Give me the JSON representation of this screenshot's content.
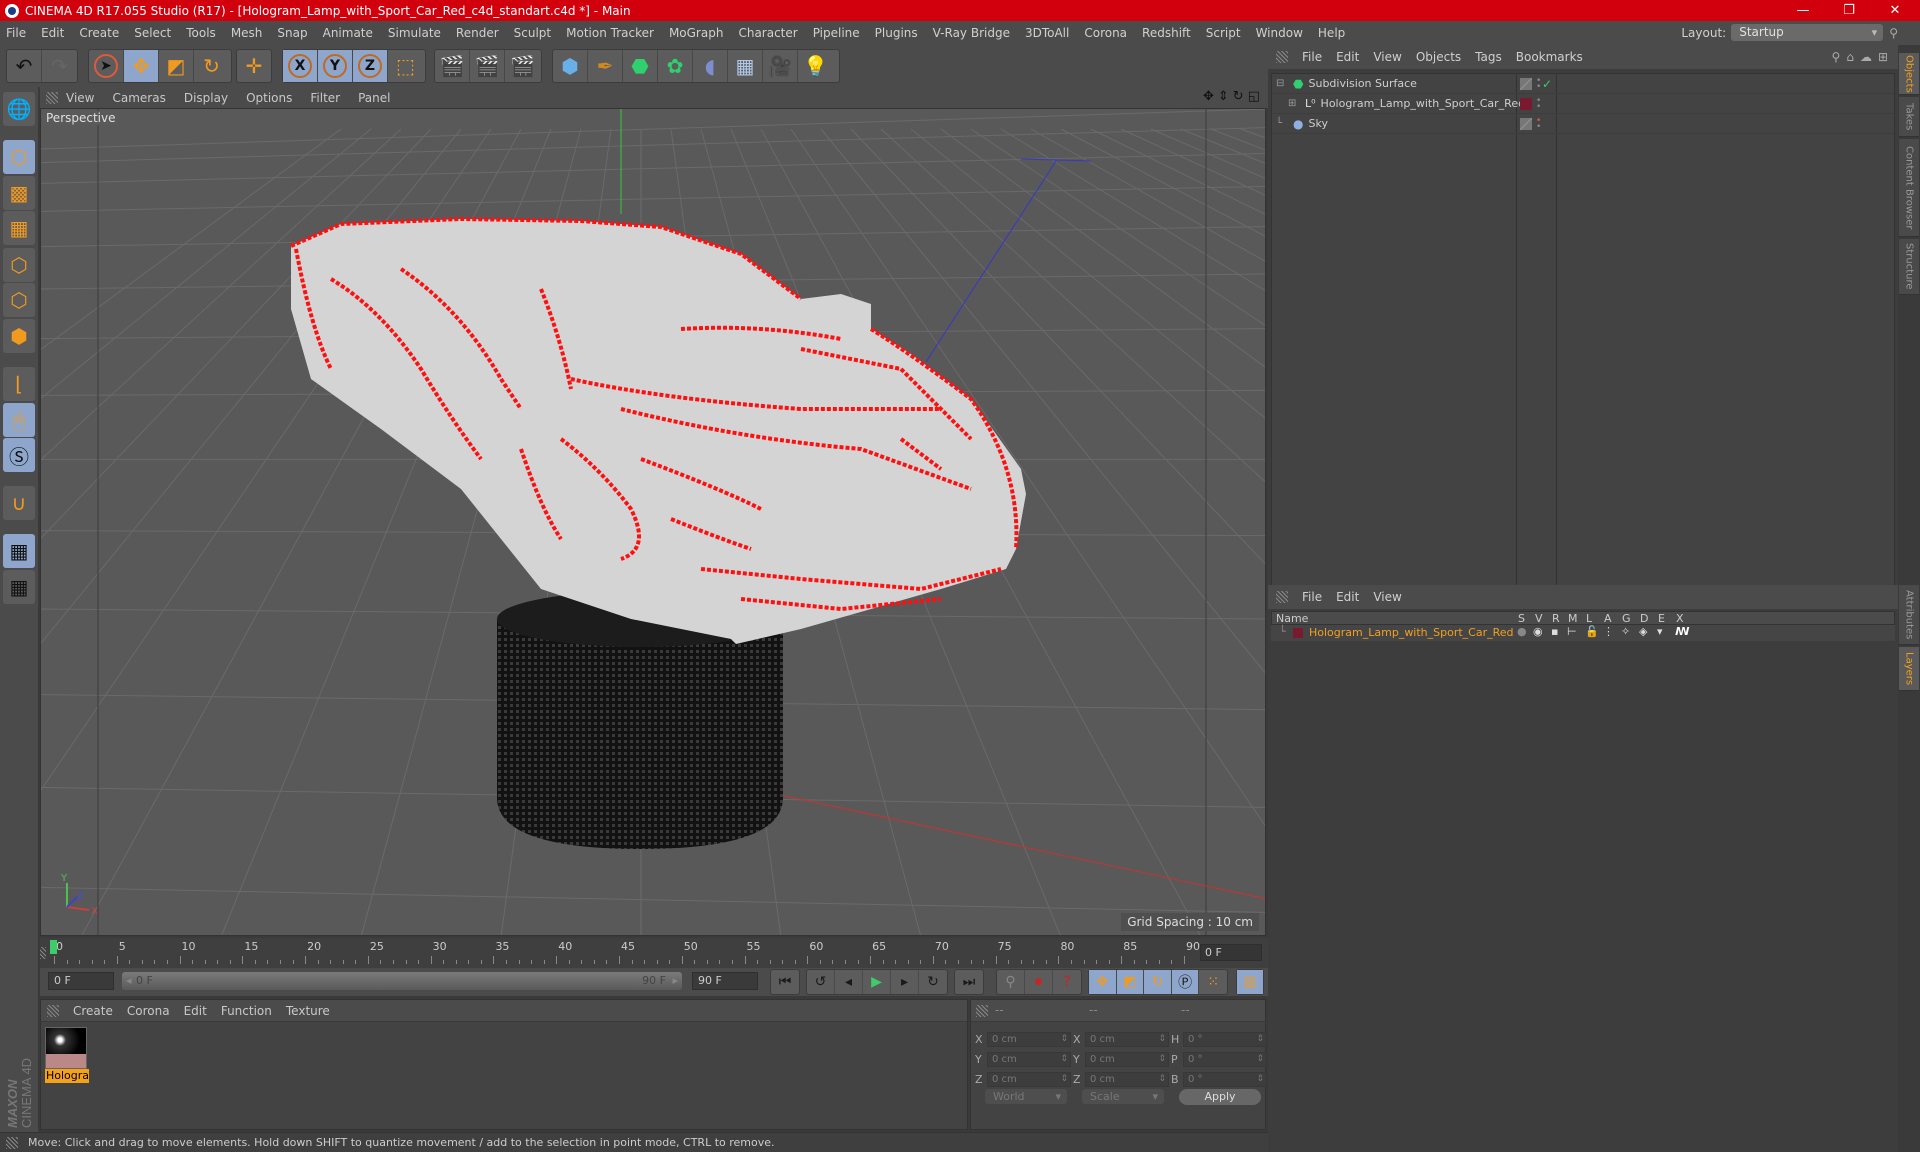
{
  "window": {
    "title": "CINEMA 4D R17.055 Studio (R17) - [Hologram_Lamp_with_Sport_Car_Red_c4d_standart.c4d *] - Main",
    "controls": [
      "minimize",
      "restore",
      "close"
    ]
  },
  "menubar": {
    "items": [
      "File",
      "Edit",
      "Create",
      "Select",
      "Tools",
      "Mesh",
      "Snap",
      "Animate",
      "Simulate",
      "Render",
      "Sculpt",
      "Motion Tracker",
      "MoGraph",
      "Character",
      "Pipeline",
      "Plugins",
      "V-Ray Bridge",
      "3DToAll",
      "Corona",
      "Redshift",
      "Script",
      "Window",
      "Help"
    ],
    "layout_label": "Layout:",
    "layout_value": "Startup"
  },
  "toolbar": {
    "groups": [
      [
        "undo-icon",
        "redo-icon"
      ],
      [
        "live-selection-icon",
        "move-icon",
        "scale-icon",
        "rotate-icon"
      ],
      [
        "last-tool-icon"
      ],
      [
        "x-axis-icon",
        "y-axis-icon",
        "z-axis-icon",
        "coordinate-system-icon"
      ],
      [
        "render-view-icon",
        "render-picture-viewer-icon",
        "render-settings-icon"
      ],
      [
        "cube-icon",
        "pen-icon",
        "subdivision-icon",
        "mograph-cloner-icon",
        "deformer-icon",
        "floor-icon",
        "camera-icon",
        "light-icon"
      ]
    ]
  },
  "left_tools": [
    "workplane-icon",
    "model-mode-icon",
    "texture-mode-icon",
    "workplane-mode-icon",
    "points-mode-icon",
    "edges-mode-icon",
    "polygons-mode-icon",
    "axis-mode-icon",
    "tweak-mode-icon",
    "soft-selection-icon",
    "snap-icon",
    "lock-workplane-icon",
    "planar-workplane-icon"
  ],
  "viewport": {
    "menu": [
      "View",
      "Cameras",
      "Display",
      "Options",
      "Filter",
      "Panel"
    ],
    "camera_label": "Perspective",
    "grid_spacing": "Grid Spacing : 10 cm",
    "nav_icons": [
      "pan-icon",
      "dolly-icon",
      "orbit-icon",
      "maximize-icon"
    ],
    "axis_labels": {
      "x": "X",
      "y": "Y",
      "z": "Z"
    },
    "colors": {
      "bg": "#595959",
      "grid": "#666666",
      "hologram": "#e8e8e8",
      "lines": "#ff0000",
      "base": "#151515",
      "x_axis": "#c83232",
      "y_axis": "#32c832",
      "z_axis": "#3232c8"
    }
  },
  "timeline": {
    "ticks": [
      0,
      5,
      10,
      15,
      20,
      25,
      30,
      35,
      40,
      45,
      50,
      55,
      60,
      65,
      70,
      75,
      80,
      85,
      90
    ],
    "current_frame": "0 F",
    "start_field": "0 F",
    "range_start": "0 F",
    "range_end": "90 F",
    "end_field": "90 F",
    "min": 0,
    "max": 90,
    "playhead": 0
  },
  "playback": {
    "transport": [
      "go-to-start-icon",
      "previous-key-icon",
      "previous-frame-icon",
      "play-icon",
      "next-frame-icon",
      "next-key-icon",
      "go-to-end-icon"
    ],
    "record": [
      "motion-record-icon",
      "record-active-icon",
      "autokey-icon"
    ],
    "key_modes": [
      "key-position-icon",
      "key-scale-icon",
      "key-rotation-icon",
      "key-parameter-icon",
      "key-pla-icon"
    ],
    "timeline_icon": "timeline-window-icon"
  },
  "materials": {
    "menu": [
      "Create",
      "Corona",
      "Edit",
      "Function",
      "Texture"
    ],
    "items": [
      {
        "label": "Hologra"
      }
    ]
  },
  "coordinates": {
    "header": [
      "--",
      "--",
      "--"
    ],
    "rows": [
      {
        "a": "X",
        "av": "0 cm",
        "b": "X",
        "bv": "0 cm",
        "c": "H",
        "cv": "0 °"
      },
      {
        "a": "Y",
        "av": "0 cm",
        "b": "Y",
        "bv": "0 cm",
        "c": "P",
        "cv": "0 °"
      },
      {
        "a": "Z",
        "av": "0 cm",
        "b": "Z",
        "bv": "0 cm",
        "c": "B",
        "cv": "0 °"
      }
    ],
    "mode": "World",
    "transform": "Scale",
    "apply": "Apply"
  },
  "objects_panel": {
    "menu": [
      "File",
      "Edit",
      "View",
      "Objects",
      "Tags",
      "Bookmarks"
    ],
    "tools": [
      "search-icon",
      "home-icon",
      "cloud-icon",
      "new-window-icon"
    ],
    "items": [
      {
        "name": "Subdivision Surface",
        "icon": "subdivision-icon",
        "indent": 0
      },
      {
        "name": "Hologram_Lamp_with_Sport_Car_Red",
        "icon": "null-object-icon",
        "indent": 1
      },
      {
        "name": "Sky",
        "icon": "sky-icon",
        "indent": 0
      }
    ]
  },
  "layers_panel": {
    "menu": [
      "File",
      "Edit",
      "View"
    ],
    "columns": [
      "Name",
      "S",
      "V",
      "R",
      "M",
      "L",
      "A",
      "G",
      "D",
      "E",
      "X"
    ],
    "rows": [
      {
        "name": "Hologram_Lamp_with_Sport_Car_Red",
        "color": "#8b1a3a"
      }
    ]
  },
  "side_tabs": {
    "top": [
      "Objects",
      "Takes",
      "Content Browser",
      "Structure"
    ],
    "bottom": [
      "Attributes",
      "Layers"
    ]
  },
  "branding": {
    "maxon": "MAXON",
    "product": "CINEMA 4D"
  },
  "status": "Move: Click and drag to move elements. Hold down SHIFT to quantize movement / add to the selection in point mode, CTRL to remove."
}
